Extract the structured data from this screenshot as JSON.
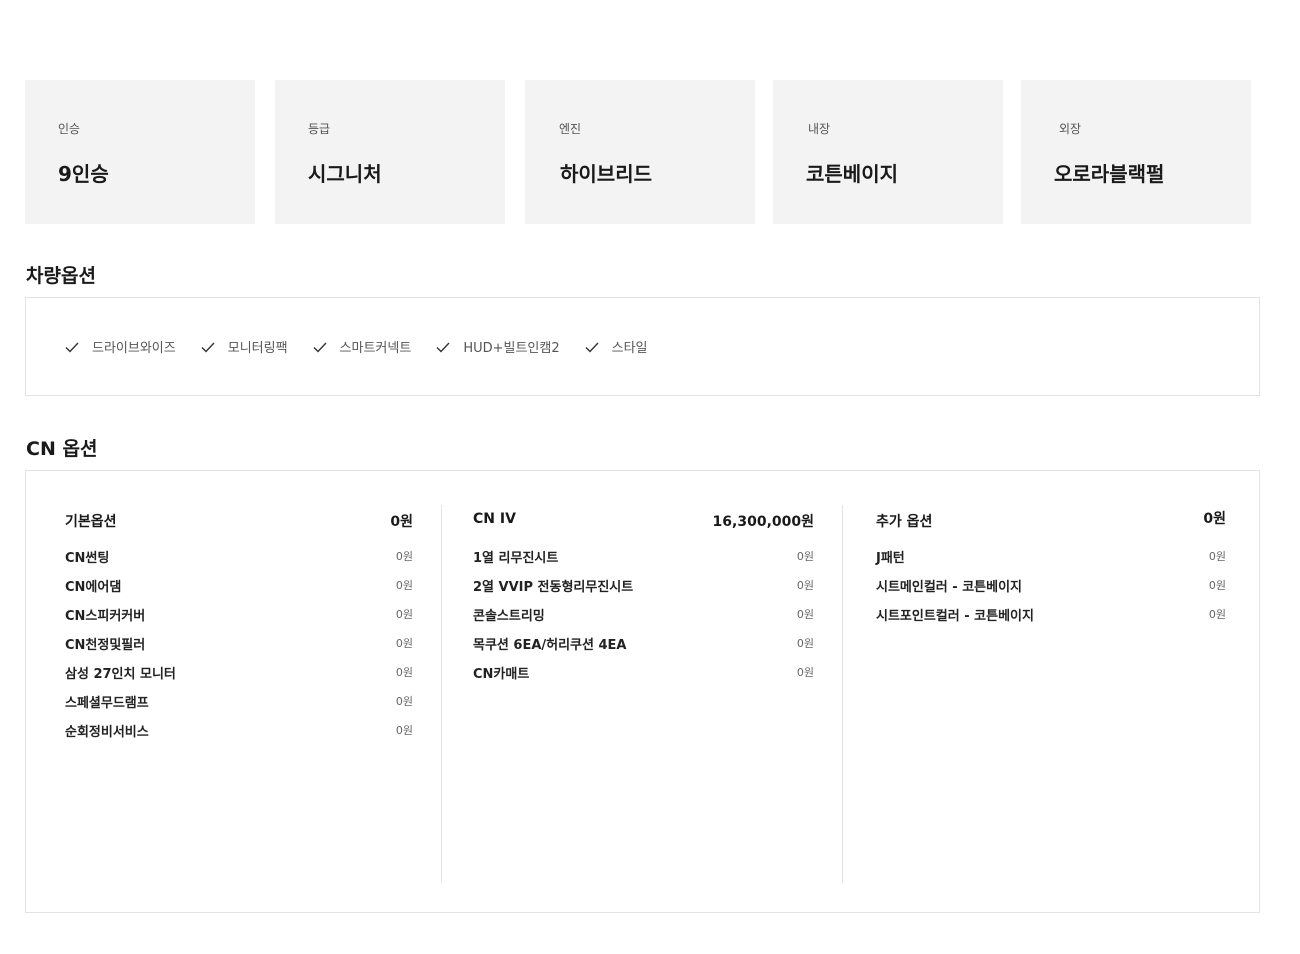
{
  "specs": [
    {
      "label": "인승",
      "value": "9인승"
    },
    {
      "label": "등급",
      "value": "시그니처"
    },
    {
      "label": "엔진",
      "value": "하이브리드"
    },
    {
      "label": "내장",
      "value": "코튼베이지"
    },
    {
      "label": "외장",
      "value": "오로라블랙펄"
    }
  ],
  "vehicle_options": {
    "title": "차량옵션",
    "items": [
      "드라이브와이즈",
      "모니터링팩",
      "스마트커넥트",
      "HUD+빌트인캠2",
      "스타일"
    ]
  },
  "cn_options": {
    "title": "CN 옵션",
    "columns": [
      {
        "title": "기본옵션",
        "price": "0원",
        "rows": [
          {
            "name": "CN썬팅",
            "price": "0원"
          },
          {
            "name": "CN에어댐",
            "price": "0원"
          },
          {
            "name": "CN스피커커버",
            "price": "0원"
          },
          {
            "name": "CN천정및필러",
            "price": "0원"
          },
          {
            "name": "삼성 27인치 모니터",
            "price": "0원"
          },
          {
            "name": "스페셜무드램프",
            "price": "0원"
          },
          {
            "name": "순회정비서비스",
            "price": "0원"
          }
        ]
      },
      {
        "title": "CN IV",
        "price": "16,300,000원",
        "rows": [
          {
            "name": "1열 리무진시트",
            "price": "0원"
          },
          {
            "name": "2열 VVIP 전동형리무진시트",
            "price": "0원"
          },
          {
            "name": "콘솔스트리밍",
            "price": "0원"
          },
          {
            "name": "목쿠션 6EA/허리쿠션 4EA",
            "price": "0원"
          },
          {
            "name": "CN카매트",
            "price": "0원"
          }
        ]
      },
      {
        "title": "추가 옵션",
        "price": "0원",
        "rows": [
          {
            "name": "J패턴",
            "price": "0원"
          },
          {
            "name": "시트메인컬러 - 코튼베이지",
            "price": "0원"
          },
          {
            "name": "시트포인트컬러 - 코튼베이지",
            "price": "0원"
          }
        ]
      }
    ]
  }
}
